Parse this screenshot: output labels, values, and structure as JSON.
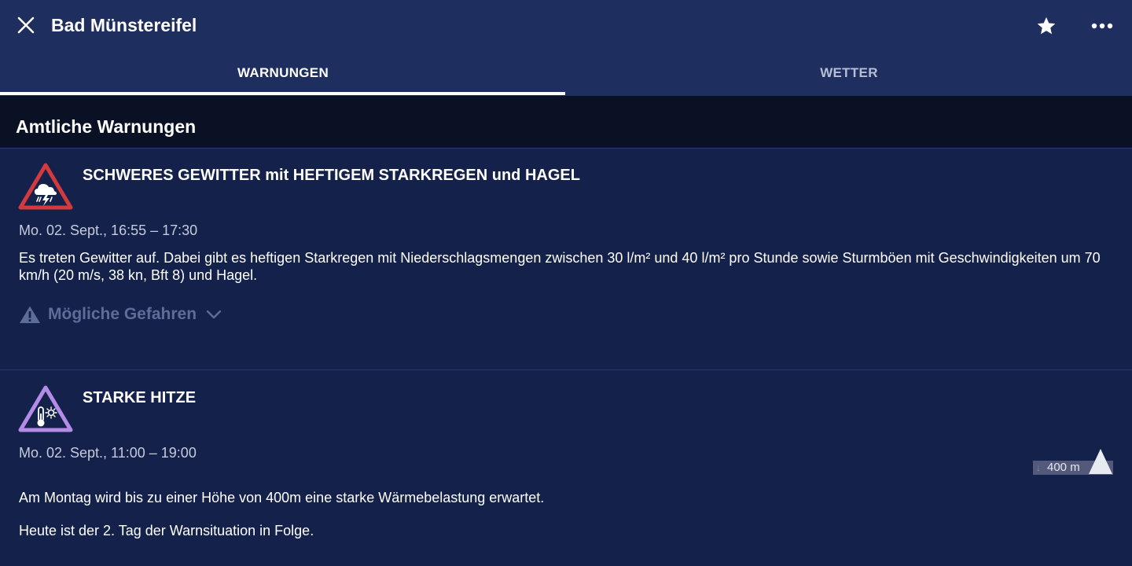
{
  "header": {
    "title": "Bad Münstereifel",
    "close_icon": "close-icon",
    "favorite_icon": "star-icon",
    "more_icon": "more-icon"
  },
  "tabs": [
    {
      "label": "WARNUNGEN",
      "active": true
    },
    {
      "label": "WETTER",
      "active": false
    }
  ],
  "section": {
    "title": "Amtliche Warnungen"
  },
  "warnings": [
    {
      "icon": "thunderstorm-warning-icon",
      "icon_color": "#d23a3e",
      "title": "SCHWERES GEWITTER mit HEFTIGEM STARKREGEN und HAGEL",
      "time": "Mo. 02. Sept., 16:55 – 17:30",
      "text": "Es treten Gewitter auf. Dabei gibt es heftigen Starkregen mit Niederschlagsmengen zwischen 30 l/m² und 40 l/m² pro Stunde sowie Sturmböen mit Geschwindigkeiten um 70 km/h (20 m/s, 38 kn, Bft 8) und Hagel.",
      "hazards_label": "Mögliche Gefahren"
    },
    {
      "icon": "heat-warning-icon",
      "icon_color": "#b48be6",
      "title": "STARKE HITZE",
      "time": "Mo. 02. Sept., 11:00 – 19:00",
      "height_badge": "400 m",
      "text_lines": [
        "Am Montag wird bis zu einer Höhe von 400m eine starke Wärmebelastung erwartet.",
        "Heute ist der 2. Tag der Warnsituation in Folge."
      ]
    }
  ],
  "colors": {
    "header_bg": "#1e2e5e",
    "page_bg": "#14214a",
    "section_bg": "#0b1124",
    "muted_text": "#5e6d98"
  }
}
